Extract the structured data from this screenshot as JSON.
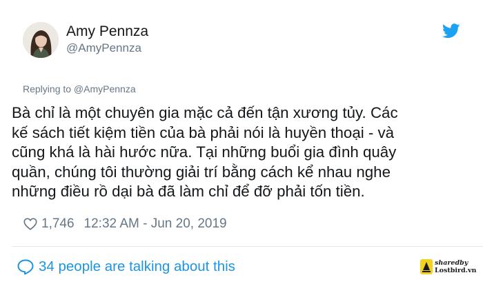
{
  "author": {
    "display_name": "Amy Pennza",
    "handle": "@AmyPennza"
  },
  "reply": {
    "label": "Replying to @AmyPennza"
  },
  "tweet": {
    "lines": [
      "Bà chỉ là một chuyên gia mặc cả đến tận xương tủy. Các",
      "kế sách tiết kiệm tiền của bà phải nói là huyền thoại - và",
      "cũng khá là hài hước nữa. Tại những buổi gia đình quây",
      "quần, chúng tôi thường giải trí bằng cách kể nhau nghe",
      "những điều rồ dại bà đã làm chỉ để đỡ phải tốn tiền."
    ]
  },
  "meta": {
    "likes": "1,746",
    "timestamp": "12:32 AM - Jun 20, 2019"
  },
  "conversation": {
    "label": "34 people are talking about this"
  },
  "watermark": {
    "line1": "sharedby",
    "line2": "Lostbird.vn"
  },
  "colors": {
    "twitter_blue": "#1da1f2",
    "link_blue": "#1b95e0",
    "muted_gray": "#657786",
    "text": "#14171a"
  },
  "icons": {
    "brand": "twitter-bird-icon",
    "like": "heart-icon",
    "reply": "speech-bubble-icon"
  }
}
